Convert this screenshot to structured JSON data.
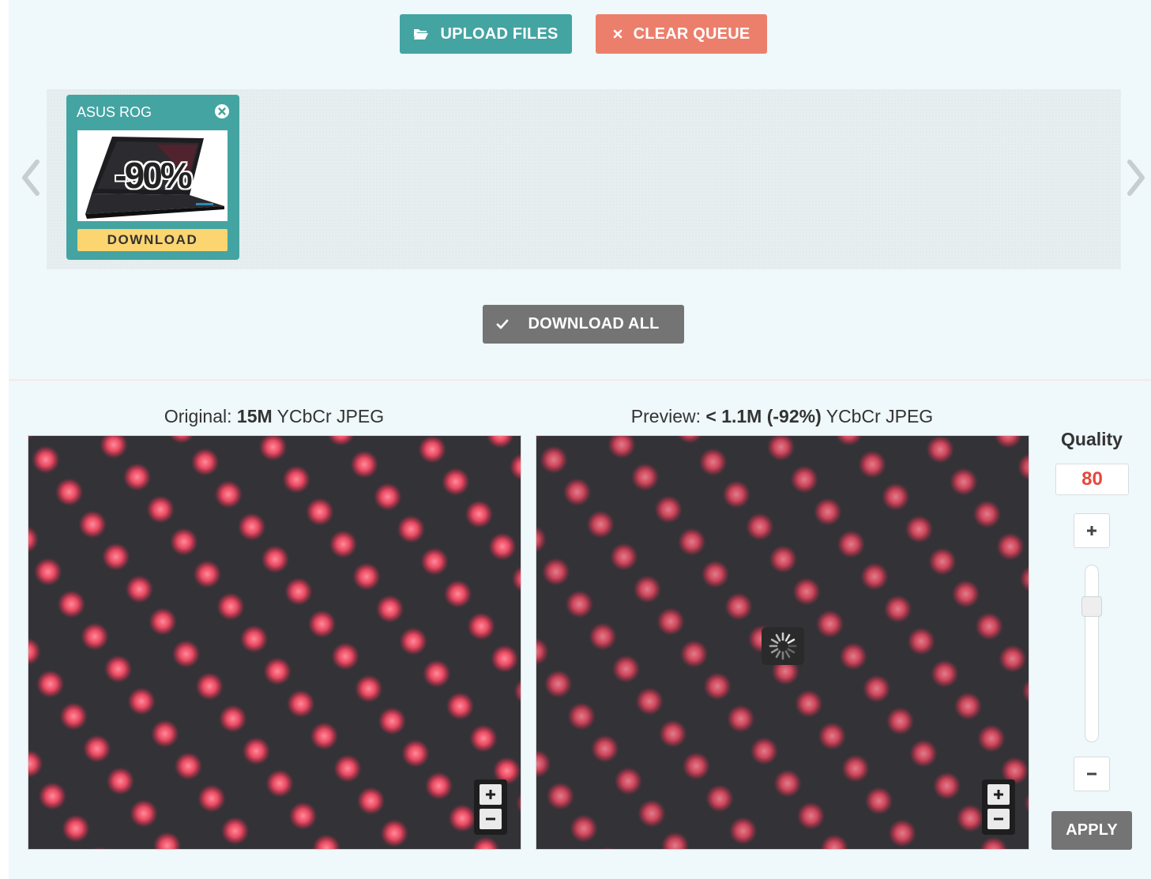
{
  "toolbar": {
    "upload_label": "UPLOAD FILES",
    "clear_label": "CLEAR QUEUE",
    "upload_icon": "folder-open-icon",
    "clear_icon": "close-icon"
  },
  "queue": {
    "items": [
      {
        "title": "ASUS ROG",
        "badge": "-90%",
        "download_label": "DOWNLOAD"
      }
    ]
  },
  "download_all_label": "DOWNLOAD ALL",
  "original": {
    "prefix": "Original: ",
    "size": "15M",
    "format": " YCbCr JPEG"
  },
  "preview": {
    "prefix": "Preview: ",
    "size": "< 1.1M (-92%)",
    "format": " YCbCr JPEG"
  },
  "quality": {
    "title": "Quality",
    "value": "80",
    "slider_fraction": 0.8,
    "apply_label": "APPLY"
  },
  "colors": {
    "teal": "#44a4a2",
    "coral": "#ec7f6c",
    "gray_button": "#747474",
    "download_yellow": "#fbd570",
    "quality_red": "#e5483d"
  }
}
